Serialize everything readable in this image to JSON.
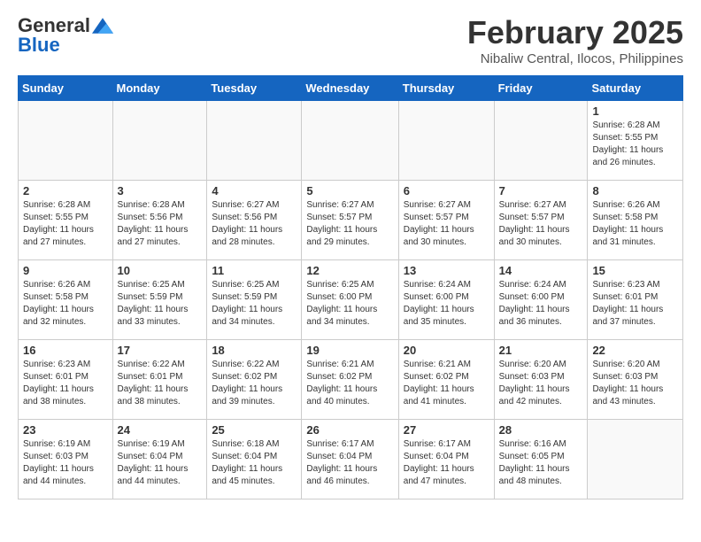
{
  "header": {
    "logo": {
      "general": "General",
      "blue": "Blue"
    },
    "title": "February 2025",
    "location": "Nibaliw Central, Ilocos, Philippines"
  },
  "weekdays": [
    "Sunday",
    "Monday",
    "Tuesday",
    "Wednesday",
    "Thursday",
    "Friday",
    "Saturday"
  ],
  "weeks": [
    [
      {
        "day": "",
        "info": ""
      },
      {
        "day": "",
        "info": ""
      },
      {
        "day": "",
        "info": ""
      },
      {
        "day": "",
        "info": ""
      },
      {
        "day": "",
        "info": ""
      },
      {
        "day": "",
        "info": ""
      },
      {
        "day": "1",
        "info": "Sunrise: 6:28 AM\nSunset: 5:55 PM\nDaylight: 11 hours and 26 minutes."
      }
    ],
    [
      {
        "day": "2",
        "info": "Sunrise: 6:28 AM\nSunset: 5:55 PM\nDaylight: 11 hours and 27 minutes."
      },
      {
        "day": "3",
        "info": "Sunrise: 6:28 AM\nSunset: 5:56 PM\nDaylight: 11 hours and 27 minutes."
      },
      {
        "day": "4",
        "info": "Sunrise: 6:27 AM\nSunset: 5:56 PM\nDaylight: 11 hours and 28 minutes."
      },
      {
        "day": "5",
        "info": "Sunrise: 6:27 AM\nSunset: 5:57 PM\nDaylight: 11 hours and 29 minutes."
      },
      {
        "day": "6",
        "info": "Sunrise: 6:27 AM\nSunset: 5:57 PM\nDaylight: 11 hours and 30 minutes."
      },
      {
        "day": "7",
        "info": "Sunrise: 6:27 AM\nSunset: 5:57 PM\nDaylight: 11 hours and 30 minutes."
      },
      {
        "day": "8",
        "info": "Sunrise: 6:26 AM\nSunset: 5:58 PM\nDaylight: 11 hours and 31 minutes."
      }
    ],
    [
      {
        "day": "9",
        "info": "Sunrise: 6:26 AM\nSunset: 5:58 PM\nDaylight: 11 hours and 32 minutes."
      },
      {
        "day": "10",
        "info": "Sunrise: 6:25 AM\nSunset: 5:59 PM\nDaylight: 11 hours and 33 minutes."
      },
      {
        "day": "11",
        "info": "Sunrise: 6:25 AM\nSunset: 5:59 PM\nDaylight: 11 hours and 34 minutes."
      },
      {
        "day": "12",
        "info": "Sunrise: 6:25 AM\nSunset: 6:00 PM\nDaylight: 11 hours and 34 minutes."
      },
      {
        "day": "13",
        "info": "Sunrise: 6:24 AM\nSunset: 6:00 PM\nDaylight: 11 hours and 35 minutes."
      },
      {
        "day": "14",
        "info": "Sunrise: 6:24 AM\nSunset: 6:00 PM\nDaylight: 11 hours and 36 minutes."
      },
      {
        "day": "15",
        "info": "Sunrise: 6:23 AM\nSunset: 6:01 PM\nDaylight: 11 hours and 37 minutes."
      }
    ],
    [
      {
        "day": "16",
        "info": "Sunrise: 6:23 AM\nSunset: 6:01 PM\nDaylight: 11 hours and 38 minutes."
      },
      {
        "day": "17",
        "info": "Sunrise: 6:22 AM\nSunset: 6:01 PM\nDaylight: 11 hours and 38 minutes."
      },
      {
        "day": "18",
        "info": "Sunrise: 6:22 AM\nSunset: 6:02 PM\nDaylight: 11 hours and 39 minutes."
      },
      {
        "day": "19",
        "info": "Sunrise: 6:21 AM\nSunset: 6:02 PM\nDaylight: 11 hours and 40 minutes."
      },
      {
        "day": "20",
        "info": "Sunrise: 6:21 AM\nSunset: 6:02 PM\nDaylight: 11 hours and 41 minutes."
      },
      {
        "day": "21",
        "info": "Sunrise: 6:20 AM\nSunset: 6:03 PM\nDaylight: 11 hours and 42 minutes."
      },
      {
        "day": "22",
        "info": "Sunrise: 6:20 AM\nSunset: 6:03 PM\nDaylight: 11 hours and 43 minutes."
      }
    ],
    [
      {
        "day": "23",
        "info": "Sunrise: 6:19 AM\nSunset: 6:03 PM\nDaylight: 11 hours and 44 minutes."
      },
      {
        "day": "24",
        "info": "Sunrise: 6:19 AM\nSunset: 6:04 PM\nDaylight: 11 hours and 44 minutes."
      },
      {
        "day": "25",
        "info": "Sunrise: 6:18 AM\nSunset: 6:04 PM\nDaylight: 11 hours and 45 minutes."
      },
      {
        "day": "26",
        "info": "Sunrise: 6:17 AM\nSunset: 6:04 PM\nDaylight: 11 hours and 46 minutes."
      },
      {
        "day": "27",
        "info": "Sunrise: 6:17 AM\nSunset: 6:04 PM\nDaylight: 11 hours and 47 minutes."
      },
      {
        "day": "28",
        "info": "Sunrise: 6:16 AM\nSunset: 6:05 PM\nDaylight: 11 hours and 48 minutes."
      },
      {
        "day": "",
        "info": ""
      }
    ]
  ]
}
